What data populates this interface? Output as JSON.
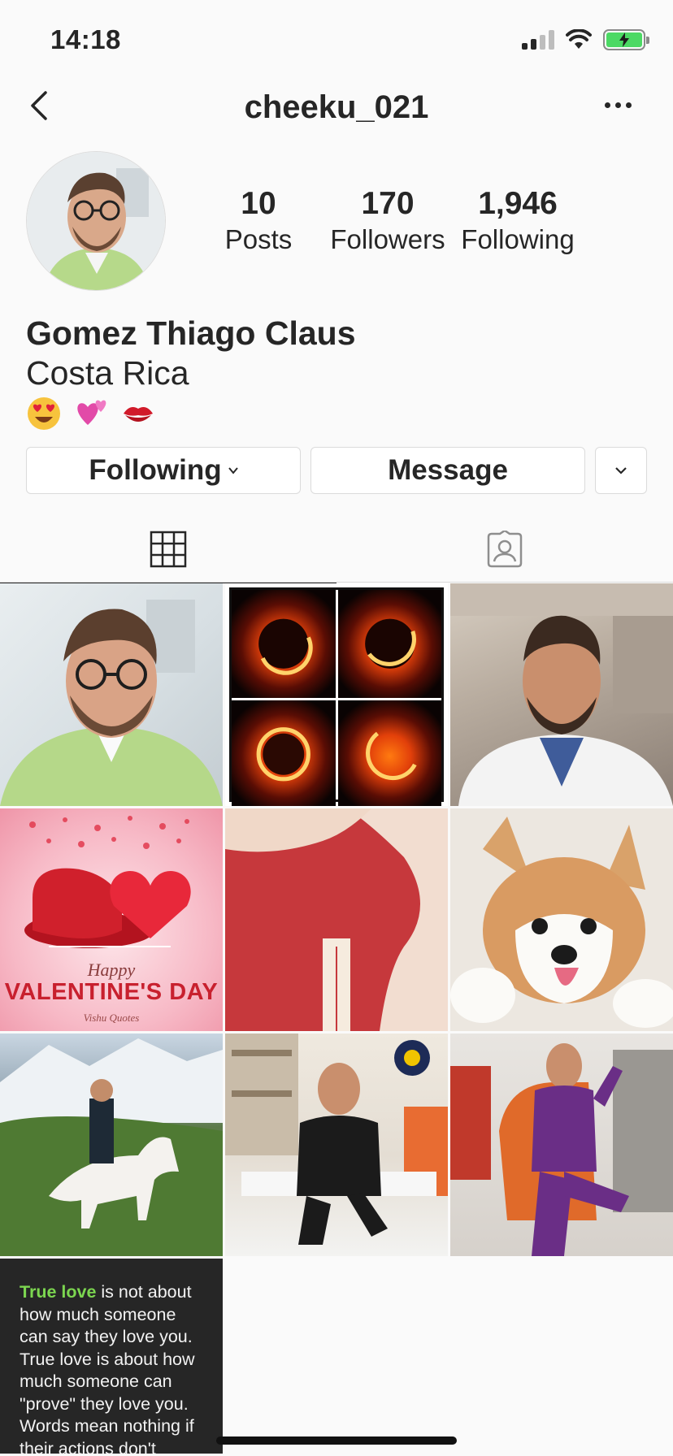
{
  "status": {
    "time": "14:18"
  },
  "nav": {
    "username": "cheeku_021"
  },
  "profile": {
    "stats": [
      {
        "value": "10",
        "label": "Posts"
      },
      {
        "value": "170",
        "label": "Followers"
      },
      {
        "value": "1,946",
        "label": "Following"
      }
    ],
    "name": "Gomez Thiago Claus",
    "location": "Costa Rica",
    "emojis": [
      "heart-eyes-emoji",
      "two-hearts-emoji",
      "kiss-mark-emoji"
    ]
  },
  "actions": {
    "following_label": "Following",
    "message_label": "Message"
  },
  "tabs": [
    "grid-icon",
    "tagged-icon"
  ],
  "posts": {
    "valentine_happy": "Happy",
    "valentine_title": "VALENTINE'S DAY",
    "valentine_sign": "Vishu Quotes",
    "quote_highlight": "True love",
    "quote_rest": " is not about how much someone can say they love you. True love is about how much someone can \"prove\" they love you. Words mean nothing if their actions don't follow."
  },
  "colors": {
    "accent_green": "#7cd650",
    "battery_green": "#4cd964",
    "text": "#262626",
    "border": "#dbdbdb"
  }
}
